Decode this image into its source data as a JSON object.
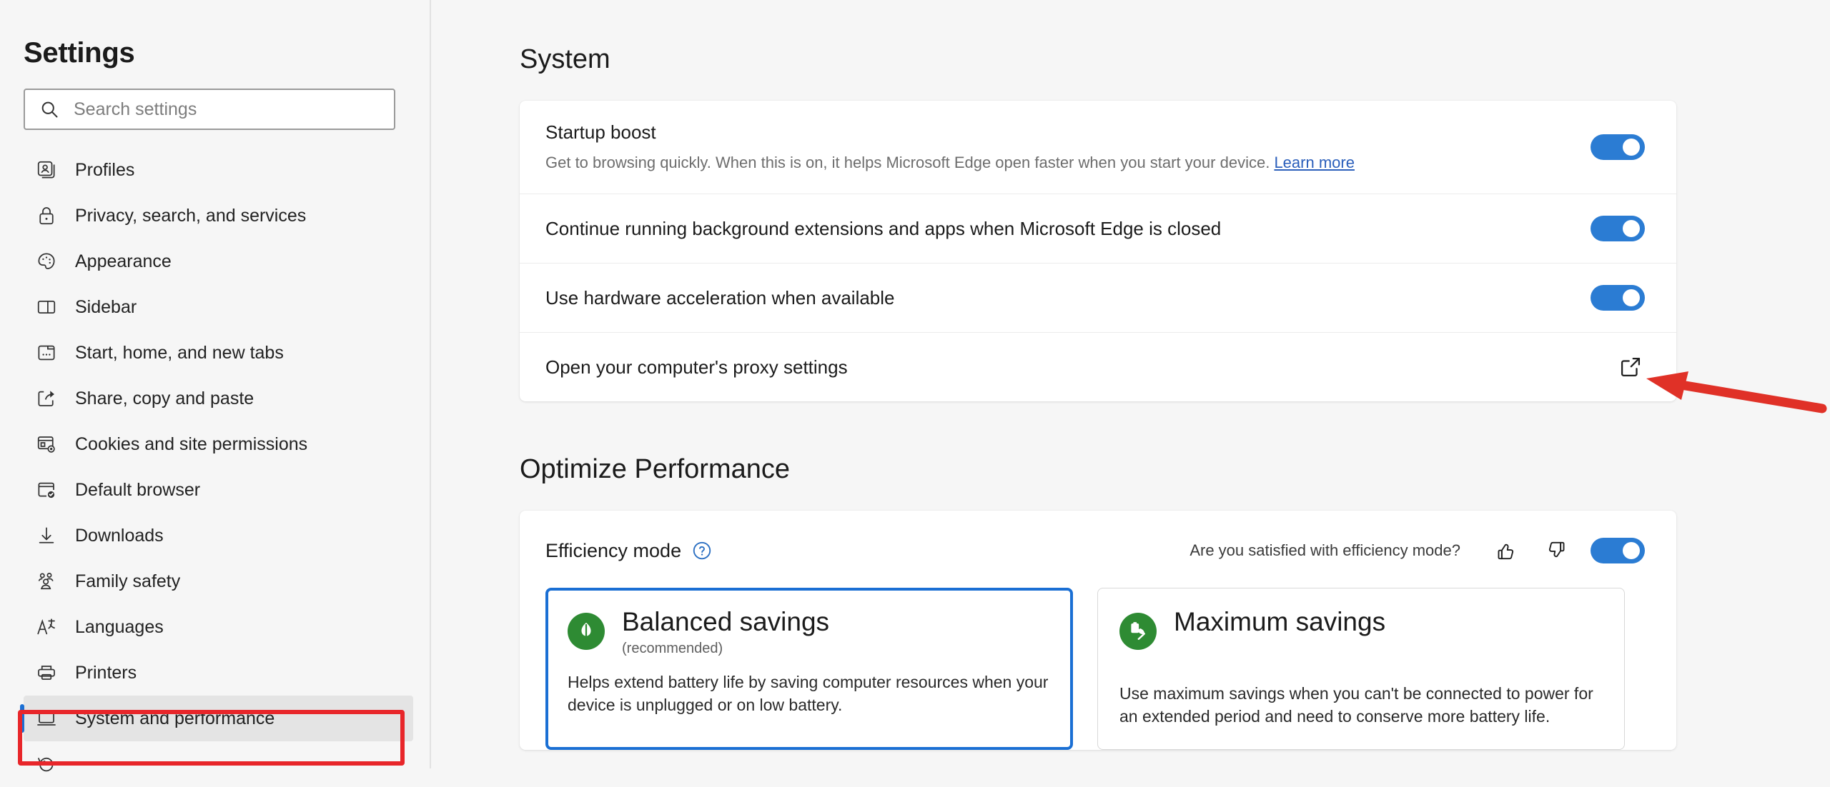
{
  "sidebar": {
    "title": "Settings",
    "search": {
      "placeholder": "Search settings",
      "value": "",
      "icon": "search-icon"
    },
    "items": [
      {
        "label": "Profiles",
        "icon": "profiles-icon",
        "selected": false
      },
      {
        "label": "Privacy, search, and services",
        "icon": "lock-icon",
        "selected": false
      },
      {
        "label": "Appearance",
        "icon": "palette-icon",
        "selected": false
      },
      {
        "label": "Sidebar",
        "icon": "sidebar-icon",
        "selected": false
      },
      {
        "label": "Start, home, and new tabs",
        "icon": "window-dots-icon",
        "selected": false
      },
      {
        "label": "Share, copy and paste",
        "icon": "share-icon",
        "selected": false
      },
      {
        "label": "Cookies and site permissions",
        "icon": "cookies-gear-icon",
        "selected": false
      },
      {
        "label": "Default browser",
        "icon": "browser-check-icon",
        "selected": false
      },
      {
        "label": "Downloads",
        "icon": "download-arrow-icon",
        "selected": false
      },
      {
        "label": "Family safety",
        "icon": "family-icon",
        "selected": false
      },
      {
        "label": "Languages",
        "icon": "language-icon",
        "selected": false
      },
      {
        "label": "Printers",
        "icon": "printer-icon",
        "selected": false
      },
      {
        "label": "System and performance",
        "icon": "monitor-icon",
        "selected": true
      }
    ]
  },
  "main": {
    "system": {
      "heading": "System",
      "rows": [
        {
          "title": "Startup boost",
          "subtitle": "Get to browsing quickly. When this is on, it helps Microsoft Edge open faster when you start your device.",
          "link": "Learn more",
          "control": "toggle",
          "toggle_on": true
        },
        {
          "title": "Continue running background extensions and apps when Microsoft Edge is closed",
          "subtitle": "",
          "link": "",
          "control": "toggle",
          "toggle_on": true
        },
        {
          "title": "Use hardware acceleration when available",
          "subtitle": "",
          "link": "",
          "control": "toggle",
          "toggle_on": true
        },
        {
          "title": "Open your computer's proxy settings",
          "subtitle": "",
          "link": "",
          "control": "external-link",
          "toggle_on": false
        }
      ]
    },
    "optimize": {
      "heading": "Optimize Performance",
      "efficiency": {
        "label": "Efficiency mode",
        "help_icon": "help-circle-icon",
        "feedback_question": "Are you satisfied with efficiency mode?",
        "thumbs_up_icon": "thumbs-up-icon",
        "thumbs_down_icon": "thumbs-down-icon",
        "toggle_on": true
      },
      "modes": [
        {
          "title": "Balanced savings",
          "note": "(recommended)",
          "description": "Helps extend battery life by saving computer resources when your device is unplugged or on low battery.",
          "icon": "leaf-badge-icon",
          "selected": true
        },
        {
          "title": "Maximum savings",
          "note": "",
          "description": "Use maximum savings when you can't be connected to power for an extended period and need to conserve more battery life.",
          "icon": "leaf-battery-badge-icon",
          "selected": false
        }
      ]
    }
  },
  "annotations": {
    "highlight_box_color": "#e8262a",
    "arrow_color": "#e03127",
    "selection_indicator_color": "#1a6fd4",
    "toggle_on_color": "#2b7cd3",
    "badge_green": "#2e8b33"
  }
}
